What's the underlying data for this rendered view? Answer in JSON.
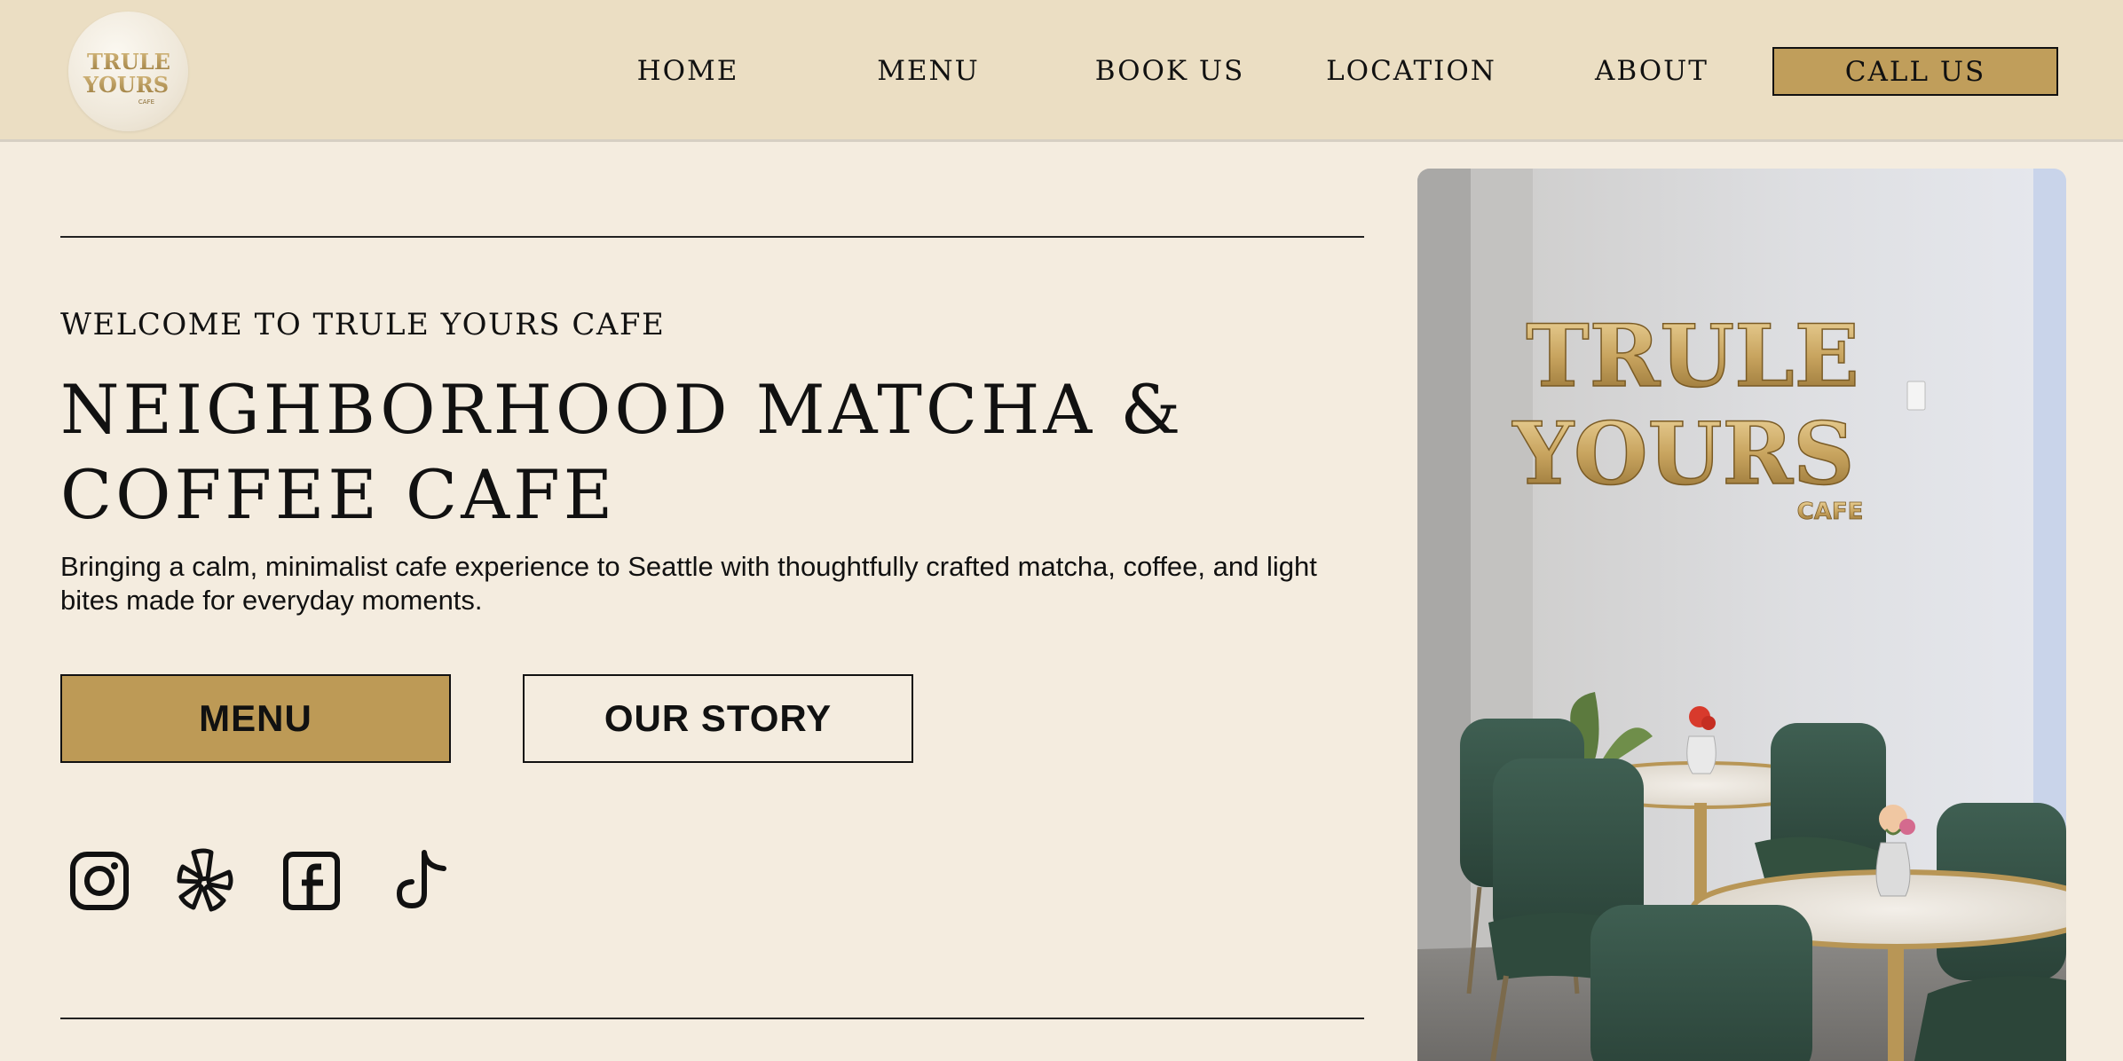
{
  "logo": {
    "line1": "TRULE",
    "line2": "YOURS",
    "line3": "CAFE"
  },
  "nav": {
    "home": "HOME",
    "menu": "MENU",
    "book": "BOOK US",
    "location": "LOCATION",
    "about": "ABOUT",
    "call": "CALL US"
  },
  "hero": {
    "welcome": "WELCOME TO TRULE YOURS CAFE",
    "headline_line1": "NEIGHBORHOOD MATCHA &",
    "headline_line2": "COFFEE CAFE",
    "description": "Bringing a calm, minimalist cafe experience to Seattle with thoughtfully crafted matcha, coffee, and light bites made for everyday moments.",
    "menu_button": "MENU",
    "story_button": "OUR STORY"
  },
  "social": [
    "instagram-icon",
    "yelp-icon",
    "facebook-icon",
    "tiktok-icon"
  ],
  "photo": {
    "sign_line1": "TRULE",
    "sign_line2": "YOURS",
    "sign_line3": "CAFE"
  },
  "colors": {
    "header_bg": "#ebdec3",
    "page_bg": "#f4ecdf",
    "accent_gold": "#bd9a56",
    "text": "#111111"
  }
}
